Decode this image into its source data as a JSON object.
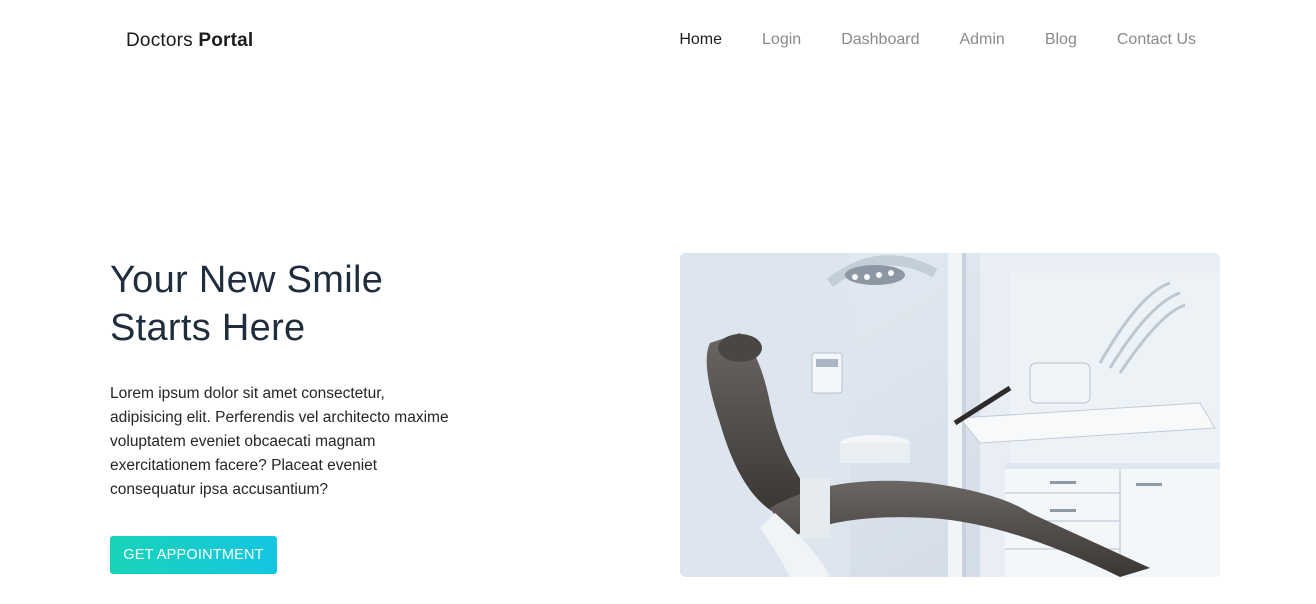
{
  "brand": {
    "name_regular": "Doctors",
    "name_bold": "Portal"
  },
  "nav": {
    "items": [
      {
        "label": "Home",
        "active": true
      },
      {
        "label": "Login",
        "active": false
      },
      {
        "label": "Dashboard",
        "active": false
      },
      {
        "label": "Admin",
        "active": false
      },
      {
        "label": "Blog",
        "active": false
      },
      {
        "label": "Contact Us",
        "active": false
      }
    ]
  },
  "hero": {
    "title_line1": "Your New Smile",
    "title_line2": "Starts Here",
    "description": "Lorem ipsum dolor sit amet consectetur, adipisicing elit. Perferendis vel architecto maxime voluptatem eveniet obcaecati magnam exercitationem facere? Placeat eveniet consequatur ipsa accusantium?",
    "cta_label": "GET APPOINTMENT"
  },
  "colors": {
    "accent_start": "#17d4b7",
    "accent_end": "#14c6e3",
    "heading": "#1f2d3d",
    "nav_inactive": "#8a8a8a"
  }
}
